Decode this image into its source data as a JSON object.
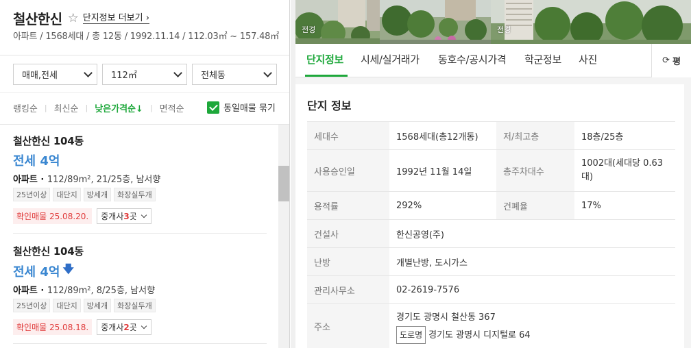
{
  "complex": {
    "name": "철산한신",
    "detail_link": "단지정보 더보기",
    "summary": "아파트 / 1568세대 / 총 12동 / 1992.11.14 / 112.03㎡ ~ 157.48㎡"
  },
  "filters": {
    "trade_type": "매매,전세",
    "area": "112㎡",
    "building": "전체동"
  },
  "sort": {
    "options": [
      "랭킹순",
      "최신순",
      "낮은가격순",
      "면적순"
    ],
    "active": "낮은가격순",
    "bundle_label": "동일매물 묶기",
    "bundle_checked": true
  },
  "listings": [
    {
      "name": "철산한신 104동",
      "price": "전세 4억",
      "price_down": false,
      "type": "아파트",
      "spec": "112/89m², 21/25층, 남서향",
      "tags": [
        "25년이상",
        "대단지",
        "방세개",
        "화장실두개"
      ],
      "confirm": "확인매물 25.08.20.",
      "agent_prefix": "중개사 ",
      "agent_count": "3",
      "agent_suffix": "곳"
    },
    {
      "name": "철산한신 104동",
      "price": "전세 4억",
      "price_down": true,
      "type": "아파트",
      "spec": "112/89m², 8/25층, 남서향",
      "tags": [
        "25년이상",
        "대단지",
        "방세개",
        "화장실두개"
      ],
      "confirm": "확인매물 25.08.18.",
      "agent_prefix": "중개사 ",
      "agent_count": "2",
      "agent_suffix": "곳"
    }
  ],
  "photos": [
    {
      "label": "전경"
    },
    {
      "label": "전경"
    }
  ],
  "tabs": [
    "단지정보",
    "시세/실거래가",
    "동호수/공시가격",
    "학군정보",
    "사진"
  ],
  "active_tab": "단지정보",
  "unit_toggle": "평",
  "info_card": {
    "title": "단지 정보",
    "rows": [
      {
        "k1": "세대수",
        "v1": "1568세대(총12개동)",
        "k2": "저/최고층",
        "v2": "18층/25층"
      },
      {
        "k1": "사용승인일",
        "v1": "1992년 11월 14일",
        "k2": "총주차대수",
        "v2": "1002대(세대당 0.63대)"
      },
      {
        "k1": "용적률",
        "v1": "292%",
        "k2": "건폐율",
        "v2": "17%"
      },
      {
        "k1": "건설사",
        "v1": "한신공영(주)"
      },
      {
        "k1": "난방",
        "v1": "개별난방, 도시가스"
      },
      {
        "k1": "관리사무소",
        "v1": "02-2619-7576"
      },
      {
        "k1": "주소",
        "v1": "경기도 광명시 철산동 367",
        "road_tag": "도로명",
        "v1b": "경기도 광명시 디지털로 64"
      }
    ]
  },
  "colors": {
    "accent_green": "#1ea83b",
    "price_blue": "#3a87d1",
    "confirm_red": "#e03a3a"
  }
}
